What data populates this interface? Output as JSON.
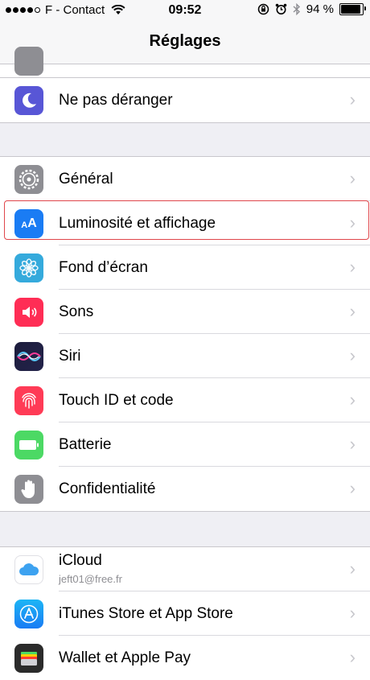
{
  "status_bar": {
    "carrier": "F - Contact",
    "time": "09:52",
    "battery_percent": "94 %",
    "battery_level": 0.94
  },
  "header": {
    "title": "Réglages"
  },
  "groups": [
    {
      "items": [
        {
          "label": "Ne pas déranger",
          "icon": "moon-icon",
          "color": "#5856d6"
        }
      ]
    },
    {
      "items": [
        {
          "label": "Général",
          "icon": "gear-icon",
          "color": "#8e8e93"
        },
        {
          "label": "Luminosité et affichage",
          "icon": "text-size-icon",
          "color": "#1a7cf4"
        },
        {
          "label": "Fond d’écran",
          "icon": "flower-icon",
          "color": "#35aadc"
        },
        {
          "label": "Sons",
          "icon": "speaker-icon",
          "color": "#ff2d55"
        },
        {
          "label": "Siri",
          "icon": "siri-icon",
          "color": "#1c1c3c"
        },
        {
          "label": "Touch ID et code",
          "icon": "fingerprint-icon",
          "color": "#ff3b56"
        },
        {
          "label": "Batterie",
          "icon": "battery-icon",
          "color": "#4cd964"
        },
        {
          "label": "Confidentialité",
          "icon": "hand-icon",
          "color": "#8e8e93"
        }
      ]
    },
    {
      "items": [
        {
          "label": "iCloud",
          "sublabel": "jeft01@free.fr",
          "icon": "icloud-icon",
          "color": "#ffffff"
        },
        {
          "label": "iTunes Store et App Store",
          "icon": "app-store-icon",
          "color": "#1d9bf0"
        },
        {
          "label": "Wallet et Apple Pay",
          "icon": "wallet-icon",
          "color": "#2b2b2b"
        }
      ]
    }
  ]
}
